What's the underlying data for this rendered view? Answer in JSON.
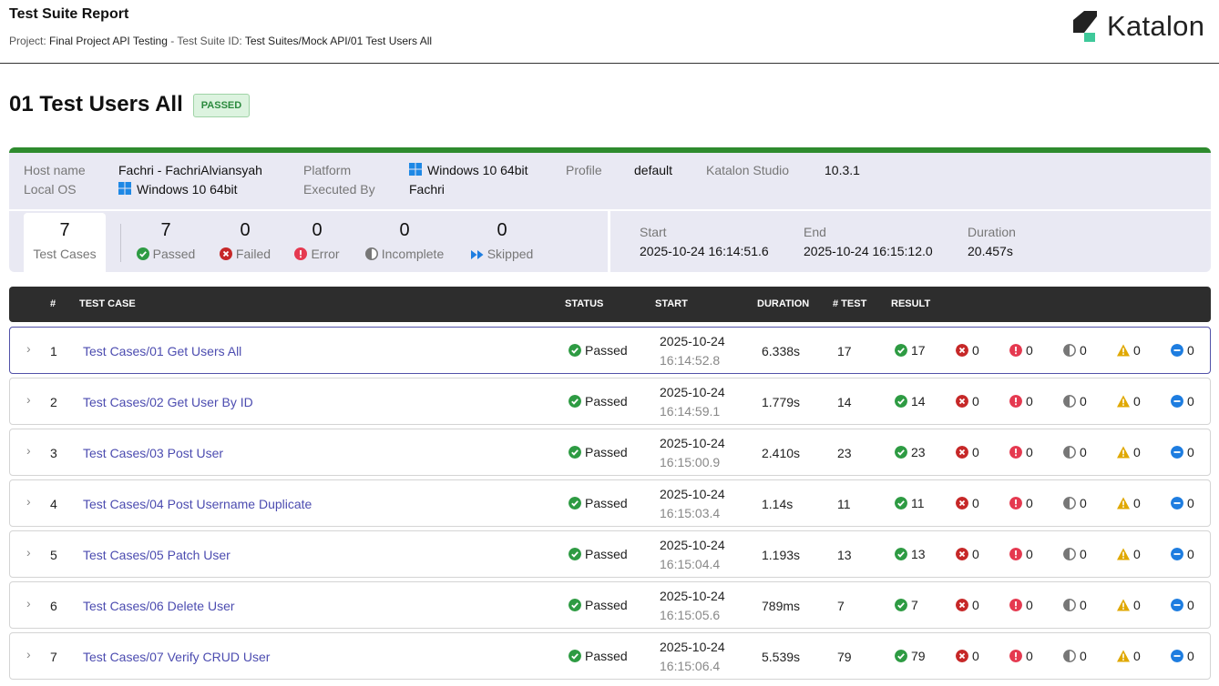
{
  "header": {
    "title": "Test Suite Report",
    "project_label": "Project:",
    "project_value": "Final Project API Testing",
    "dash": "-",
    "suite_id_label": "Test Suite ID:",
    "suite_id_value": "Test Suites/Mock API/01 Test Users All",
    "logo_text": "Katalon"
  },
  "suite": {
    "name": "01 Test Users All",
    "status": "PASSED"
  },
  "info": {
    "host_label": "Host name",
    "host_value": "Fachri - FachriAlviansyah",
    "os_label": "Local OS",
    "os_value": "Windows 10 64bit",
    "platform_label": "Platform",
    "platform_value": "Windows 10 64bit",
    "executed_label": "Executed By",
    "executed_value": "Fachri",
    "profile_label": "Profile",
    "profile_value": "default",
    "studio_label": "Katalon Studio",
    "studio_value": "10.3.1"
  },
  "stats": {
    "total": "7",
    "total_label": "Test Cases",
    "passed": "7",
    "passed_label": "Passed",
    "failed": "0",
    "failed_label": "Failed",
    "error": "0",
    "error_label": "Error",
    "incomplete": "0",
    "incomplete_label": "Incomplete",
    "skipped": "0",
    "skipped_label": "Skipped"
  },
  "timing": {
    "start_label": "Start",
    "start_value": "2025-10-24 16:14:51.6",
    "end_label": "End",
    "end_value": "2025-10-24 16:15:12.0",
    "duration_label": "Duration",
    "duration_value": "20.457s"
  },
  "table": {
    "headers": {
      "idx": "#",
      "name": "TEST CASE",
      "status": "STATUS",
      "start": "START",
      "duration": "DURATION",
      "tests": "# TEST",
      "result": "RESULT"
    },
    "rows": [
      {
        "idx": "1",
        "name": "Test Cases/01 Get Users All",
        "status": "Passed",
        "date": "2025-10-24",
        "time": "16:14:52.8",
        "duration": "6.338s",
        "tests": "17",
        "passed": "17",
        "failed": "0",
        "error": "0",
        "incomplete": "0",
        "warning": "0",
        "skipped": "0"
      },
      {
        "idx": "2",
        "name": "Test Cases/02 Get User By ID",
        "status": "Passed",
        "date": "2025-10-24",
        "time": "16:14:59.1",
        "duration": "1.779s",
        "tests": "14",
        "passed": "14",
        "failed": "0",
        "error": "0",
        "incomplete": "0",
        "warning": "0",
        "skipped": "0"
      },
      {
        "idx": "3",
        "name": "Test Cases/03 Post User",
        "status": "Passed",
        "date": "2025-10-24",
        "time": "16:15:00.9",
        "duration": "2.410s",
        "tests": "23",
        "passed": "23",
        "failed": "0",
        "error": "0",
        "incomplete": "0",
        "warning": "0",
        "skipped": "0"
      },
      {
        "idx": "4",
        "name": "Test Cases/04 Post Username Duplicate",
        "status": "Passed",
        "date": "2025-10-24",
        "time": "16:15:03.4",
        "duration": "1.14s",
        "tests": "11",
        "passed": "11",
        "failed": "0",
        "error": "0",
        "incomplete": "0",
        "warning": "0",
        "skipped": "0"
      },
      {
        "idx": "5",
        "name": "Test Cases/05 Patch User",
        "status": "Passed",
        "date": "2025-10-24",
        "time": "16:15:04.4",
        "duration": "1.193s",
        "tests": "13",
        "passed": "13",
        "failed": "0",
        "error": "0",
        "incomplete": "0",
        "warning": "0",
        "skipped": "0"
      },
      {
        "idx": "6",
        "name": "Test Cases/06 Delete User",
        "status": "Passed",
        "date": "2025-10-24",
        "time": "16:15:05.6",
        "duration": "789ms",
        "tests": "7",
        "passed": "7",
        "failed": "0",
        "error": "0",
        "incomplete": "0",
        "warning": "0",
        "skipped": "0"
      },
      {
        "idx": "7",
        "name": "Test Cases/07 Verify CRUD User",
        "status": "Passed",
        "date": "2025-10-24",
        "time": "16:15:06.4",
        "duration": "5.539s",
        "tests": "79",
        "passed": "79",
        "failed": "0",
        "error": "0",
        "incomplete": "0",
        "warning": "0",
        "skipped": "0"
      }
    ]
  },
  "colors": {
    "passed": "#2e9b43",
    "failed": "#c62828",
    "error": "#e53950",
    "incomplete": "#777777",
    "warning": "#e0a800",
    "skipped": "#1e7de0",
    "link": "#4c4cb0",
    "accent_bar": "#2e8b2e"
  }
}
